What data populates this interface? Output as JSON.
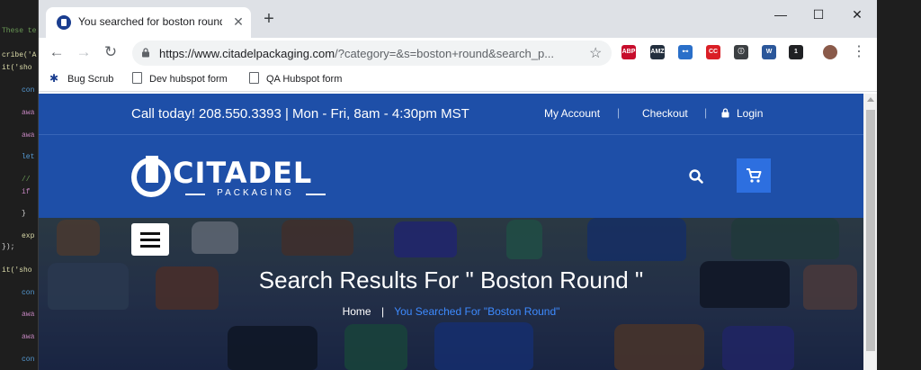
{
  "editor": {
    "lines": [
      {
        "text": "These te",
        "color": "#6a9955"
      },
      {
        "text": "cribe('A",
        "color": "#dcdcaa"
      },
      {
        "text": "it('sho",
        "color": "#dcdcaa"
      },
      {
        "text": "con",
        "color": "#569cd6"
      },
      {
        "text": "awa",
        "color": "#c586c0"
      },
      {
        "text": "awa",
        "color": "#c586c0"
      },
      {
        "text": "let",
        "color": "#569cd6"
      },
      {
        "text": "//",
        "color": "#6a9955"
      },
      {
        "text": "if",
        "color": "#c586c0"
      },
      {
        "text": "}",
        "color": "#d4d4d4"
      },
      {
        "text": "exp",
        "color": "#dcdcaa"
      },
      {
        "text": "});",
        "color": "#d4d4d4"
      },
      {
        "text": "it('sho",
        "color": "#dcdcaa"
      },
      {
        "text": "con",
        "color": "#569cd6"
      },
      {
        "text": "awa",
        "color": "#c586c0"
      },
      {
        "text": "awa",
        "color": "#c586c0"
      },
      {
        "text": "con",
        "color": "#569cd6"
      }
    ]
  },
  "browser": {
    "tab_title": "You searched for boston round -",
    "tab_close": "✕",
    "new_tab": "+",
    "window_controls": {
      "minimize": "—",
      "maximize": "☐",
      "close": "✕"
    },
    "nav": {
      "back": "←",
      "forward": "→",
      "reload": "↻"
    },
    "url_host": "https://www.citadelpackaging.com",
    "url_path": "/?category=&s=boston+round&search_p...",
    "bookmark_star": "☆",
    "extensions": [
      {
        "name": "adblock-plus-icon",
        "label": "ABP",
        "color": "#c70d2c"
      },
      {
        "name": "amazon-assistant-icon",
        "label": "AMZ",
        "color": "#232f3e"
      },
      {
        "name": "key-extension-icon",
        "label": "⊷",
        "color": "#2a6fc9"
      },
      {
        "name": "creative-cloud-icon",
        "label": "CC",
        "color": "#da1f26"
      },
      {
        "name": "info-icon",
        "label": "ⓘ",
        "color": "#3c4043"
      },
      {
        "name": "office-icon",
        "label": "W",
        "color": "#2b579a"
      },
      {
        "name": "camera-badge-icon",
        "label": "1",
        "color": "#202124"
      }
    ],
    "menu": "⋮",
    "bookmarks": [
      "Bug Scrub",
      "Dev hubspot form",
      "QA Hubspot form"
    ]
  },
  "site": {
    "call_text": "Call today! 208.550.3393 | Mon - Fri, 8am - 4:30pm MST",
    "links": {
      "account": "My Account",
      "checkout": "Checkout",
      "login": "Login"
    },
    "separator": "|",
    "logo_text": "CITADEL",
    "logo_sub": "PACKAGING",
    "hero_title": "Search Results For \" Boston Round \"",
    "breadcrumb_home": "Home",
    "breadcrumb_sep": "|",
    "breadcrumb_current": "You Searched For \"Boston Round\"",
    "colors": {
      "brand_blue": "#1e4fa8",
      "cart_blue": "#2d6fe0",
      "crumb_blue": "#3d8bff"
    }
  }
}
